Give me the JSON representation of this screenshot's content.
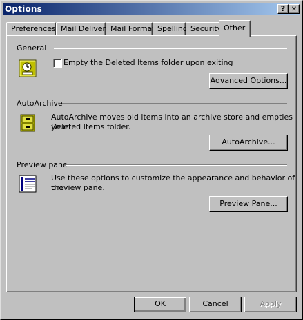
{
  "window": {
    "title": "Options",
    "help_button": "?",
    "close_button": "✕"
  },
  "tabs": [
    {
      "label": "Preferences"
    },
    {
      "label": "Mail Delivery"
    },
    {
      "label": "Mail Format"
    },
    {
      "label": "Spelling"
    },
    {
      "label": "Security"
    },
    {
      "label": "Other"
    }
  ],
  "general": {
    "heading": "General",
    "icon": "general-settings-icon",
    "checkbox_label": "Empty the Deleted Items folder upon exiting",
    "checkbox_checked": false,
    "button": "Advanced Options..."
  },
  "autoarchive": {
    "heading": "AutoArchive",
    "icon": "archive-cabinet-icon",
    "description_line1": "AutoArchive moves old items into an archive store and empties your",
    "description_line2": "Deleted Items folder.",
    "button": "AutoArchive..."
  },
  "preview": {
    "heading": "Preview pane",
    "icon": "preview-pane-icon",
    "description_line1": "Use these options to customize the appearance and behavior of the",
    "description_line2": "preview pane.",
    "button": "Preview Pane..."
  },
  "footer": {
    "ok": "OK",
    "cancel": "Cancel",
    "apply": "Apply"
  }
}
